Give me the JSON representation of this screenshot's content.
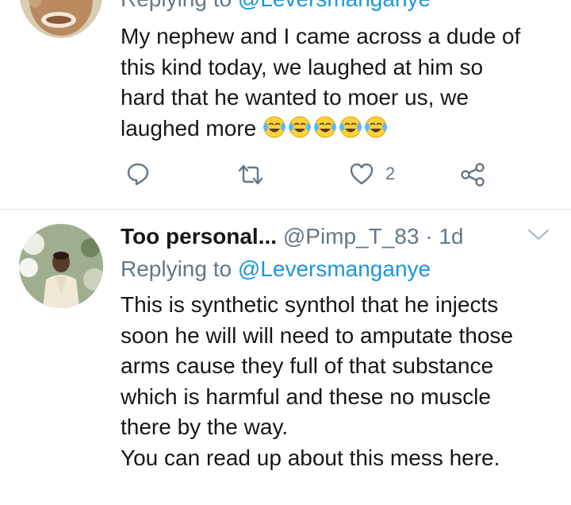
{
  "tweet1": {
    "replying_label": "Replying to",
    "replying_handle": "@Leversmanganye",
    "body_lines": [
      "My nephew and I came across a dude of",
      "this kind today, we laughed at him so",
      "hard that he wanted to moer us, we",
      "laughed more"
    ],
    "emojis": [
      "tears-of-joy",
      "tears-of-joy",
      "tears-of-joy",
      "tears-of-joy",
      "tears-of-joy"
    ],
    "actions": {
      "reply_icon": "reply-icon",
      "retweet_icon": "retweet-icon",
      "like_icon": "heart-icon",
      "like_count": "2",
      "share_icon": "share-icon"
    }
  },
  "tweet2": {
    "display_name": "Too personal...",
    "handle": "@Pimp_T_83",
    "separator": "·",
    "time": "1d",
    "replying_label": "Replying to",
    "replying_handle": "@Leversmanganye",
    "body_lines": [
      "This is synthetic synthol that he injects",
      "soon he will will need to amputate those",
      "arms cause they full of that substance",
      "which is harmful and these no muscle",
      "there by the way.",
      "You can read up about this mess here."
    ]
  },
  "colors": {
    "link": "#1b95e0",
    "muted": "#657786",
    "text": "#14171a",
    "divider": "#e1e8ed"
  }
}
